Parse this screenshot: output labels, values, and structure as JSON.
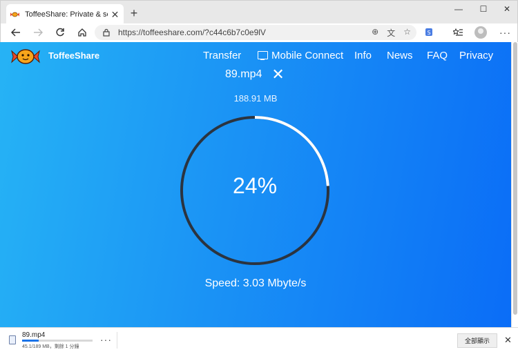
{
  "browser": {
    "tab_title": "ToffeeShare: Private & secure file sharing",
    "tab_close": "✕",
    "new_tab": "+",
    "window_controls": {
      "minimize": "—",
      "maximize": "☐",
      "close": "✕"
    },
    "url": "https://toffeeshare.com/?c44c6b7c0e9lV",
    "menu": "···"
  },
  "site": {
    "brand": "ToffeeShare",
    "nav": [
      "Transfer",
      "Mobile Connect",
      "Info",
      "News",
      "FAQ",
      "Privacy"
    ],
    "accent": "#1a92f5"
  },
  "transfer": {
    "filename": "89.mp4",
    "close": "✕",
    "filesize": "188.91 MB",
    "progress_label": "24%",
    "progress_fraction": 0.24,
    "speed": "Speed: 3.03 Mbyte/s"
  },
  "downloads": {
    "filename": "89.mp4",
    "status": "45.1/189 MB，剩餘 1 分鐘",
    "progress_fraction": 0.24,
    "more": "···",
    "show_all": "全部顯示",
    "close": "✕"
  }
}
